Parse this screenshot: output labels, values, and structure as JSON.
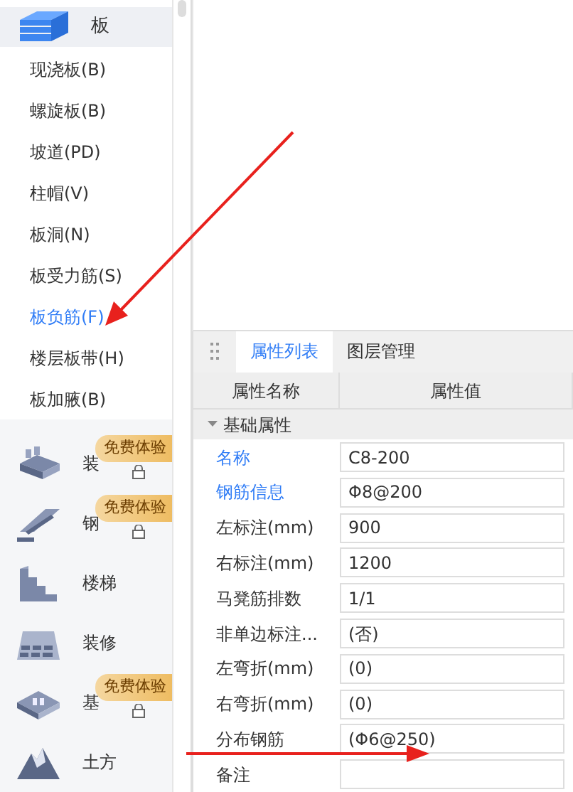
{
  "sidebar": {
    "header": {
      "label": "板",
      "selected": true
    },
    "items": [
      {
        "label": "现浇板(B)",
        "selected": false
      },
      {
        "label": "螺旋板(B)",
        "selected": false
      },
      {
        "label": "坡道(PD)",
        "selected": false
      },
      {
        "label": "柱帽(V)",
        "selected": false
      },
      {
        "label": "板洞(N)",
        "selected": false
      },
      {
        "label": "板受力筋(S)",
        "selected": false
      },
      {
        "label": "板负筋(F)",
        "selected": true
      },
      {
        "label": "楼层板带(H)",
        "selected": false
      },
      {
        "label": "板加腋(B)",
        "selected": false
      }
    ],
    "categories": [
      {
        "label": "装",
        "kind": "slab",
        "badge": "免费体验",
        "locked": true
      },
      {
        "label": "钢",
        "kind": "beam",
        "badge": "免费体验",
        "locked": true
      },
      {
        "label": "楼梯",
        "kind": "stairs",
        "locked": false
      },
      {
        "label": "装修",
        "kind": "tile",
        "locked": false
      },
      {
        "label": "基",
        "kind": "pit",
        "badge": "免费体验",
        "locked": true
      },
      {
        "label": "土方",
        "kind": "mountain",
        "locked": false
      }
    ]
  },
  "panel": {
    "tabs": [
      {
        "label": "属性列表",
        "selected": true
      },
      {
        "label": "图层管理",
        "selected": false
      }
    ],
    "columns": [
      "属性名称",
      "属性值"
    ],
    "group": {
      "label": "基础属性",
      "expanded": true
    },
    "rows": [
      {
        "name": "名称",
        "value": "C8-200",
        "highlight": true
      },
      {
        "name": "钢筋信息",
        "value": "Φ8@200",
        "highlight": true
      },
      {
        "name": "左标注(mm)",
        "value": "900",
        "highlight": false
      },
      {
        "name": "右标注(mm)",
        "value": "1200",
        "highlight": false
      },
      {
        "name": "马凳筋排数",
        "value": "1/1",
        "highlight": false
      },
      {
        "name": "非单边标注...",
        "value": "(否)",
        "highlight": false
      },
      {
        "name": "左弯折(mm)",
        "value": "(0)",
        "highlight": false
      },
      {
        "name": "右弯折(mm)",
        "value": "(0)",
        "highlight": false
      },
      {
        "name": "分布钢筋",
        "value": "(Φ6@250)",
        "highlight": false
      },
      {
        "name": "备注",
        "value": "",
        "highlight": false
      }
    ]
  }
}
